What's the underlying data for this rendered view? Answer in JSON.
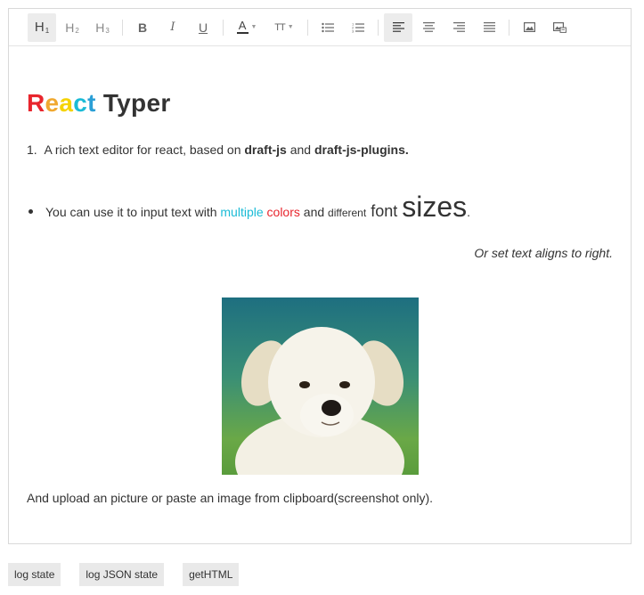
{
  "toolbar": {
    "h1": {
      "main": "H",
      "sub": "1"
    },
    "h2": {
      "main": "H",
      "sub": "2"
    },
    "h3": {
      "main": "H",
      "sub": "3"
    },
    "bold": "B",
    "italic": "I",
    "underline": "U",
    "font_color": "A",
    "font_size": "TT"
  },
  "content": {
    "title": {
      "letters": [
        "R",
        "e",
        "a",
        "c",
        "t"
      ],
      "letter_colors": [
        "#e8252d",
        "#f0a830",
        "#f5d300",
        "#1bbbd6",
        "#2a9fd6"
      ],
      "rest": " Typer"
    },
    "ordered_item": {
      "number": "1.",
      "text_before": "A rich text editor for react, based on ",
      "bold1": "draft-js",
      "middle": " and ",
      "bold2": "draft-js-plugins."
    },
    "bullet_item": {
      "text_before": "You can use it to input text with ",
      "cyan_word": "multiple",
      "space": " ",
      "red_word": "colors",
      "and": " and ",
      "small_word": "different",
      "mid_word": " font ",
      "large_word": "sizes",
      "end": "."
    },
    "right_aligned": "Or set text aligns to right.",
    "image_alt": "puppy photo",
    "footer_text": "And upload an picture or paste an image from clipboard(screenshot only)."
  },
  "buttons": {
    "log_state": "log state",
    "log_json_state": "log JSON state",
    "get_html": "getHTML"
  },
  "colors": {
    "accent_cyan": "#1bbbd6",
    "accent_red": "#e8252d"
  }
}
